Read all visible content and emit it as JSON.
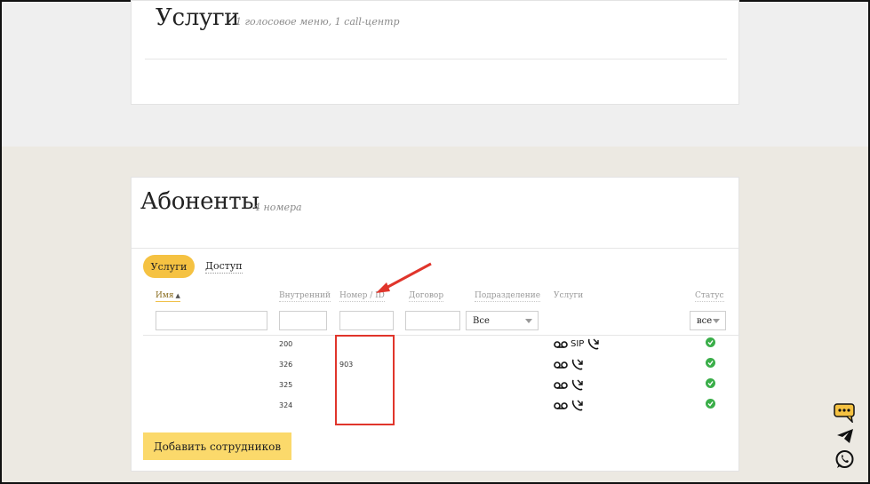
{
  "services_card": {
    "title": "Услуги",
    "subtitle": "1 голосовое меню, 1 call-центр"
  },
  "subscribers_card": {
    "title": "Абоненты",
    "subtitle": "4 номера",
    "tabs": [
      {
        "label": "Услуги",
        "active": true
      },
      {
        "label": "Доступ",
        "active": false
      }
    ],
    "columns": {
      "name": "Имя",
      "internal": "Внутренний",
      "number": "Номер / ID",
      "contract": "Договор",
      "department": "Подразделение",
      "services": "Услуги",
      "status": "Статус"
    },
    "filters": {
      "department_value": "Все",
      "status_value": "все"
    },
    "rows": [
      {
        "name": "",
        "internal": "200",
        "number": "",
        "contract": "",
        "department": "",
        "services": [
          "voicemail-icon",
          "SIP",
          "call-forward-icon"
        ],
        "sip_label": "SIP",
        "status": "active"
      },
      {
        "name": "",
        "internal": "326",
        "number": "903",
        "contract": "",
        "department": "",
        "services": [
          "voicemail-icon",
          "call-forward-icon"
        ],
        "status": "active"
      },
      {
        "name": "",
        "internal": "325",
        "number": "",
        "contract": "",
        "department": "",
        "services": [
          "voicemail-icon",
          "call-forward-icon"
        ],
        "status": "active"
      },
      {
        "name": "",
        "internal": "324",
        "number": "",
        "contract": "",
        "department": "",
        "services": [
          "voicemail-icon",
          "call-forward-icon"
        ],
        "status": "active"
      }
    ],
    "add_button_label": "Добавить сотрудников"
  },
  "colors": {
    "accent": "#f5c242",
    "add_button": "#fbd96b",
    "status_ok": "#3aae49",
    "annotation_red": "#e0352b"
  }
}
